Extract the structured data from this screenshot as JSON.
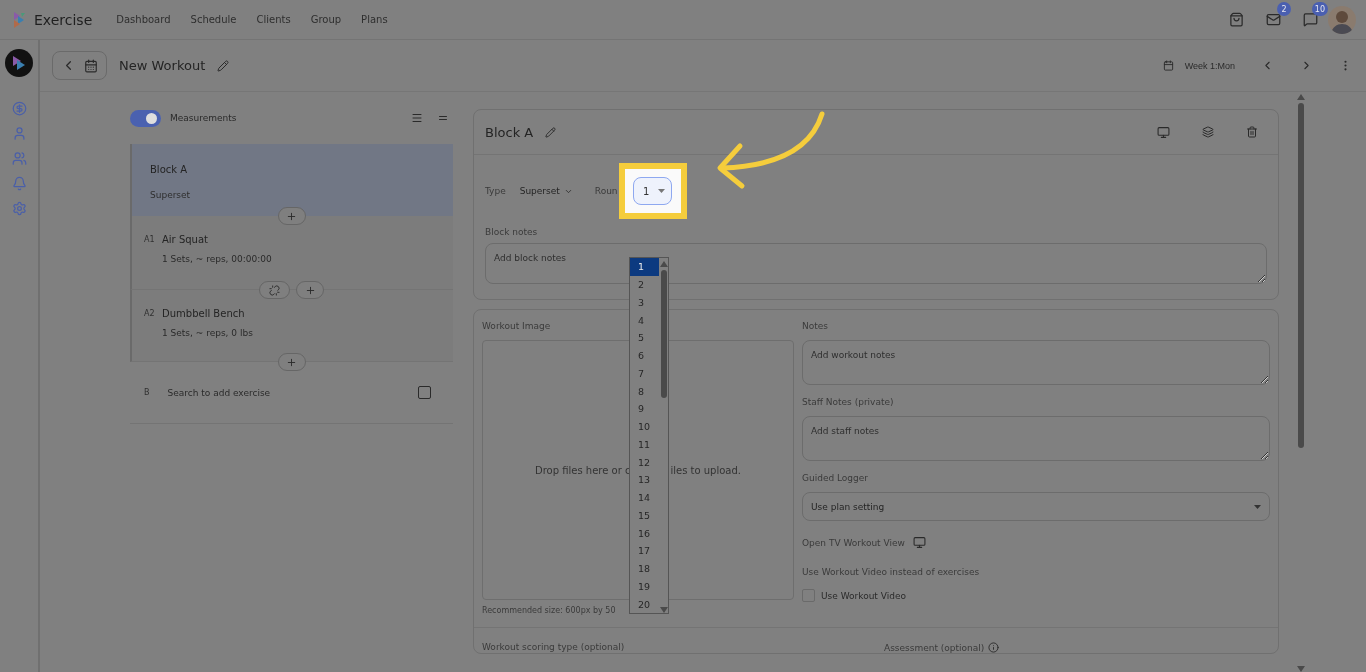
{
  "app": {
    "title": "Exercise"
  },
  "nav": [
    {
      "label": "Dashboard",
      "selected": false
    },
    {
      "label": "Schedule",
      "selected": false
    },
    {
      "label": "Clients",
      "selected": false
    },
    {
      "label": "Group",
      "selected": false
    },
    {
      "label": "Plans",
      "selected": false
    }
  ],
  "header": {
    "mail_badge": "2",
    "chat_badge": "10"
  },
  "page": {
    "title": "New Workout",
    "week": "Week 1:Mon"
  },
  "measurements": {
    "label": "Measurements",
    "on": true
  },
  "blocks": [
    {
      "title": "Block A",
      "type": "Superset",
      "selected": true,
      "exercises": [
        {
          "index": "A1",
          "name": "Air Squat",
          "detail": "1 Sets, ~ reps, 00:00:00"
        },
        {
          "index": "A2",
          "name": "Dumbbell Bench",
          "detail": "1 Sets, ~ reps, 0 lbs"
        }
      ]
    }
  ],
  "add_exercise": {
    "index": "B",
    "placeholder": "Search to add exercise",
    "checked": false
  },
  "block_editor": {
    "title": "Block A",
    "type_label": "Type",
    "type_value": "Superset",
    "rounds_label": "Roun",
    "rounds_value": "1",
    "notes_label": "Block notes",
    "notes_placeholder": "Add block notes"
  },
  "rounds_dropdown": {
    "options": [
      {
        "label": "1",
        "selected": true
      },
      {
        "label": "2",
        "selected": false
      },
      {
        "label": "3",
        "selected": false
      },
      {
        "label": "4",
        "selected": false
      },
      {
        "label": "5",
        "selected": false
      },
      {
        "label": "6",
        "selected": false
      },
      {
        "label": "7",
        "selected": false
      },
      {
        "label": "8",
        "selected": false
      },
      {
        "label": "9",
        "selected": false
      },
      {
        "label": "10",
        "selected": false
      },
      {
        "label": "11",
        "selected": false
      },
      {
        "label": "12",
        "selected": false
      },
      {
        "label": "13",
        "selected": false
      },
      {
        "label": "14",
        "selected": false
      },
      {
        "label": "15",
        "selected": false
      },
      {
        "label": "16",
        "selected": false
      },
      {
        "label": "17",
        "selected": false
      },
      {
        "label": "18",
        "selected": false
      },
      {
        "label": "19",
        "selected": false
      },
      {
        "label": "20",
        "selected": false
      }
    ]
  },
  "workout": {
    "image_label": "Workout Image",
    "drop_text_before": "Drop files here or c",
    "drop_text_after": "iles to upload.",
    "recommended": "Recommended size: 600px by 50",
    "notes_label": "Notes",
    "notes_placeholder": "Add workout notes",
    "staff_label": "Staff Notes (private)",
    "staff_placeholder": "Add staff notes",
    "logger_label": "Guided Logger",
    "logger_value": "Use plan setting",
    "tv_label": "Open TV Workout View",
    "video_label": "Use Workout Video instead of exercises",
    "video_checkbox": {
      "label": "Use Workout Video",
      "checked": false
    },
    "scoring_label": "Workout scoring type (optional)",
    "assessment_label": "Assessment (optional)"
  }
}
